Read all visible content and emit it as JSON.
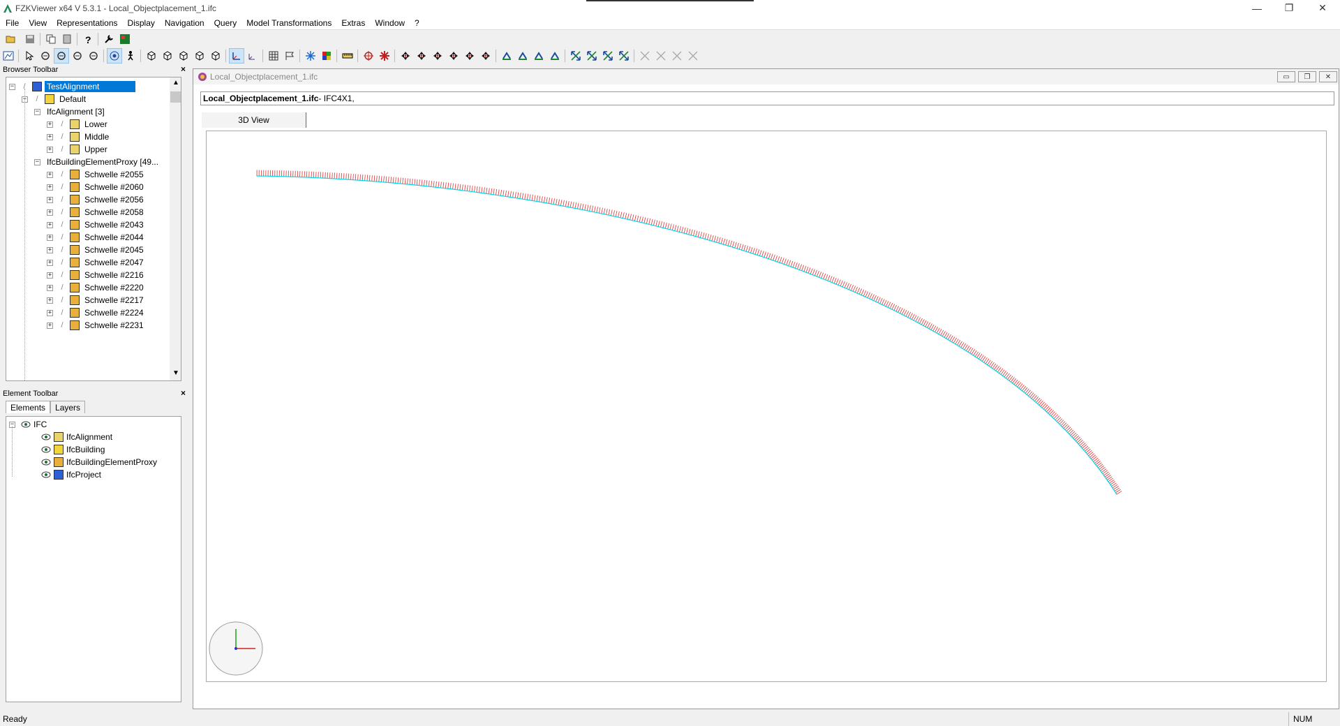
{
  "window": {
    "title": "FZKViewer x64 V 5.3.1 - Local_Objectplacement_1.ifc",
    "minimize": "—",
    "restore": "❐",
    "close": "✕"
  },
  "menu": [
    "File",
    "View",
    "Representations",
    "Display",
    "Navigation",
    "Query",
    "Model Transformations",
    "Extras",
    "Window",
    "?"
  ],
  "browser": {
    "header": "Browser Toolbar",
    "close": "×",
    "tree": [
      {
        "label": "TestAlignment",
        "selected": true
      },
      {
        "label": "Default"
      },
      {
        "label": "IfcAlignment [3]"
      },
      {
        "label": "Lower"
      },
      {
        "label": "Middle"
      },
      {
        "label": "Upper"
      },
      {
        "label": "IfcBuildingElementProxy [49..."
      },
      {
        "label": "Schwelle #2055"
      },
      {
        "label": "Schwelle #2060"
      },
      {
        "label": "Schwelle #2056"
      },
      {
        "label": "Schwelle #2058"
      },
      {
        "label": "Schwelle #2043"
      },
      {
        "label": "Schwelle #2044"
      },
      {
        "label": "Schwelle #2045"
      },
      {
        "label": "Schwelle #2047"
      },
      {
        "label": "Schwelle #2216"
      },
      {
        "label": "Schwelle #2220"
      },
      {
        "label": "Schwelle #2217"
      },
      {
        "label": "Schwelle #2224"
      },
      {
        "label": "Schwelle #2231"
      }
    ]
  },
  "element": {
    "header": "Element Toolbar",
    "close": "×",
    "tabs": [
      "Elements",
      "Layers"
    ],
    "root": "IFC",
    "items": [
      "IfcAlignment",
      "IfcBuilding",
      "IfcBuildingElementProxy",
      "IfcProject"
    ]
  },
  "document": {
    "mdi_title": "Local_Objectplacement_1.ifc",
    "info_file": "Local_Objectplacement_1.ifc",
    "info_schema": " - IFC4X1,",
    "view_tab": "3D View"
  },
  "colors": {
    "alignment_line": "#00d8e8",
    "sleepers": "#e03030",
    "selection": "#0078d7"
  },
  "status": {
    "left": "Ready",
    "right": "NUM"
  }
}
